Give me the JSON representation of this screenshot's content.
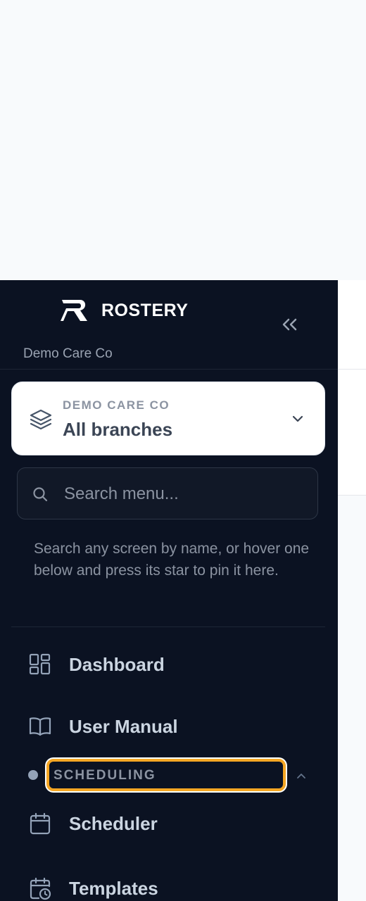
{
  "app": {
    "brand_name": "ROSTERY",
    "org_subtitle": "Demo Care Co"
  },
  "branch_selector": {
    "org_label": "DEMO CARE CO",
    "branch_name": "All branches"
  },
  "search": {
    "placeholder": "Search menu...",
    "value": ""
  },
  "hint": "Search any screen by name, or hover one below and press its star to pin it here.",
  "nav": [
    {
      "label": "Dashboard",
      "icon": "dashboard-grid-icon"
    },
    {
      "label": "User Manual",
      "icon": "book-open-icon"
    }
  ],
  "section": {
    "label": "SCHEDULING",
    "highlight_color": "#f5a623"
  },
  "section_items": [
    {
      "label": "Scheduler",
      "icon": "calendar-icon"
    },
    {
      "label": "Templates",
      "icon": "calendar-clock-icon"
    }
  ],
  "colors": {
    "sidebar_bg": "#0b1222",
    "accent": "#f5a623",
    "card_bg": "#ffffff"
  }
}
